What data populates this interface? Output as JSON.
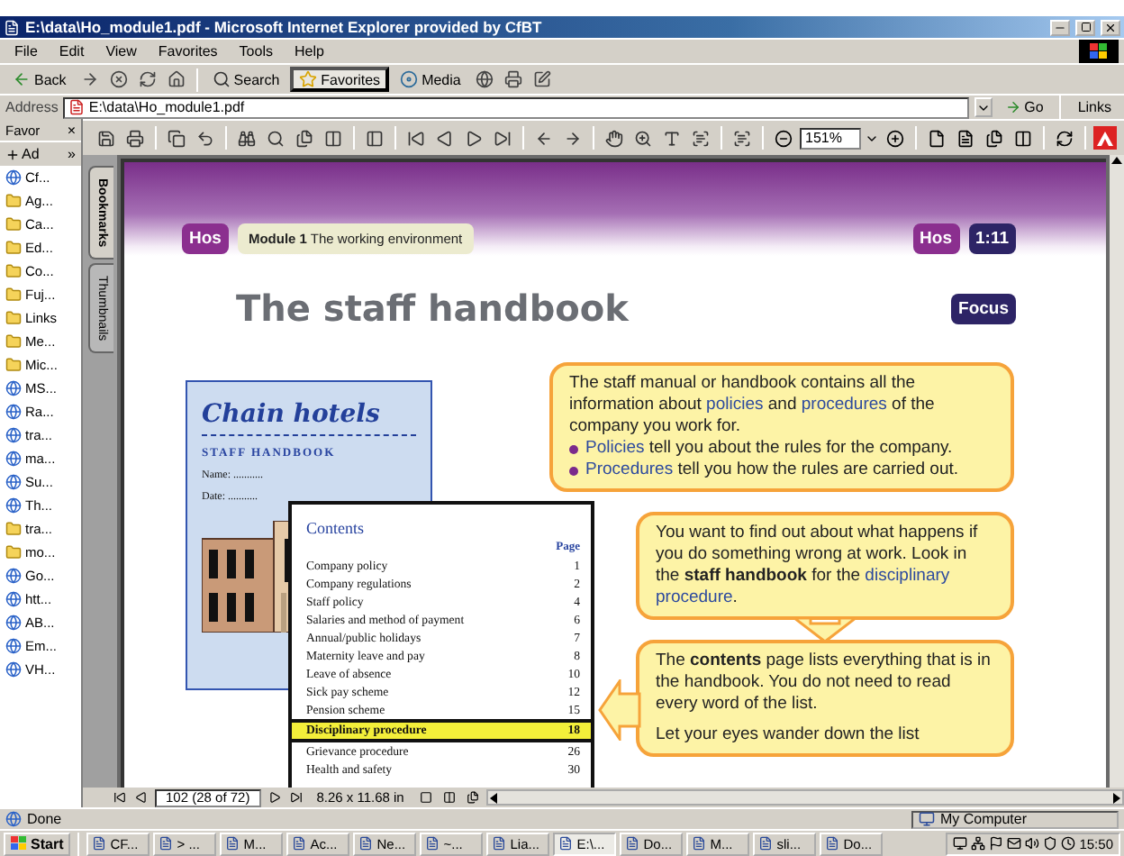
{
  "window": {
    "title": "E:\\data\\Ho_module1.pdf - Microsoft Internet Explorer provided by CfBT"
  },
  "menu": [
    "File",
    "Edit",
    "View",
    "Favorites",
    "Tools",
    "Help"
  ],
  "toolbar": [
    {
      "label": "Back",
      "kind": "back",
      "selected": false
    },
    {
      "label": "Search",
      "kind": "search",
      "selected": false
    },
    {
      "label": "Favorites",
      "kind": "favorites",
      "selected": true
    },
    {
      "label": "Media",
      "kind": "media",
      "selected": false
    }
  ],
  "address": {
    "label": "Address",
    "value": "E:\\data\\Ho_module1.pdf",
    "go": "Go",
    "links": "Links"
  },
  "favorites": {
    "title": "Favor",
    "close": "×",
    "add": "Ad",
    "more": "»",
    "items": [
      {
        "label": "Cf...",
        "kind": "page"
      },
      {
        "label": "Ag...",
        "kind": "folder"
      },
      {
        "label": "Ca...",
        "kind": "folder"
      },
      {
        "label": "Ed...",
        "kind": "folder"
      },
      {
        "label": "Co...",
        "kind": "folder"
      },
      {
        "label": "Fuj...",
        "kind": "folder"
      },
      {
        "label": "Links",
        "kind": "folder"
      },
      {
        "label": "Me...",
        "kind": "folder"
      },
      {
        "label": "Mic...",
        "kind": "folder"
      },
      {
        "label": "MS...",
        "kind": "page"
      },
      {
        "label": "Ra...",
        "kind": "page"
      },
      {
        "label": "tra...",
        "kind": "page"
      },
      {
        "label": "ma...",
        "kind": "page"
      },
      {
        "label": "Su...",
        "kind": "page"
      },
      {
        "label": "Th...",
        "kind": "page"
      },
      {
        "label": "tra...",
        "kind": "folder"
      },
      {
        "label": "mo...",
        "kind": "folder"
      },
      {
        "label": "Go...",
        "kind": "page"
      },
      {
        "label": "htt...",
        "kind": "page"
      },
      {
        "label": "AB...",
        "kind": "page"
      },
      {
        "label": "Em...",
        "kind": "page"
      },
      {
        "label": "VH...",
        "kind": "page"
      }
    ]
  },
  "reader": {
    "zoom": "151%",
    "side_tabs": [
      {
        "label": "Bookmarks",
        "selected": true
      },
      {
        "label": "Thumbnails",
        "selected": false
      }
    ],
    "page_field": "102 (28 of 72)",
    "page_size": "8.26 x 11.68 in"
  },
  "document": {
    "header": {
      "left_badge": "Hos",
      "module": "**Module 1** The working environment",
      "right_badge": "Hos",
      "page_badge": "1:11"
    },
    "title": "The staff handbook",
    "focus": "Focus",
    "cover": {
      "brand": "Chain hotels",
      "title": "STAFF HANDBOOK",
      "fields": [
        "Name: ...........",
        "Date: ..........."
      ]
    },
    "contents": {
      "title": "Contents",
      "page_heading": "Page",
      "rows": [
        {
          "item": "Company policy",
          "page": "1",
          "selected": false
        },
        {
          "item": "Company regulations",
          "page": "2",
          "selected": false
        },
        {
          "item": "Staff policy",
          "page": "4",
          "selected": false
        },
        {
          "item": "Salaries and method of payment",
          "page": "6",
          "selected": false
        },
        {
          "item": "Annual/public holidays",
          "page": "7",
          "selected": false
        },
        {
          "item": "Maternity leave and pay",
          "page": "8",
          "selected": false
        },
        {
          "item": "Leave of absence",
          "page": "10",
          "selected": false
        },
        {
          "item": "Sick pay scheme",
          "page": "12",
          "selected": false
        },
        {
          "item": "Pension scheme",
          "page": "15",
          "selected": false
        },
        {
          "item": "Disciplinary procedure",
          "page": "18",
          "selected": true
        },
        {
          "item": "Grievance procedure",
          "page": "26",
          "selected": false
        },
        {
          "item": "Health and safety",
          "page": "30",
          "selected": false
        }
      ]
    },
    "callouts": [
      {
        "kind": "plain",
        "paragraphs": [
          [
            {
              "text": "The staff manual or handbook contains all the information about ",
              "kind": "plain"
            },
            {
              "text": "policies",
              "kind": "term"
            },
            {
              "text": " and ",
              "kind": "plain"
            },
            {
              "text": "procedures",
              "kind": "term"
            },
            {
              "text": " of the company you work for.",
              "kind": "plain"
            }
          ]
        ],
        "bullets": [
          [
            {
              "text": "Policies",
              "kind": "term"
            },
            {
              "text": " tell you about the rules for the company.",
              "kind": "plain"
            }
          ],
          [
            {
              "text": "Procedures",
              "kind": "term"
            },
            {
              "text": " tell you how the rules are carried out.",
              "kind": "plain"
            }
          ]
        ]
      },
      {
        "kind": "down",
        "paragraphs": [
          [
            {
              "text": "You want to find out about what happens if you do something wrong at work. Look in the ",
              "kind": "plain"
            },
            {
              "text": "staff handbook",
              "kind": "bold"
            },
            {
              "text": " for the ",
              "kind": "plain"
            },
            {
              "text": "disciplinary procedure",
              "kind": "term"
            },
            {
              "text": ".",
              "kind": "plain"
            }
          ]
        ]
      },
      {
        "kind": "left",
        "paragraphs": [
          [
            {
              "text": "The ",
              "kind": "plain"
            },
            {
              "text": "contents",
              "kind": "bold"
            },
            {
              "text": " page lists everything that is in the handbook. You do not need to read every word of the list.",
              "kind": "plain"
            }
          ],
          [
            {
              "text": "Let your eyes wander down the list",
              "kind": "plain"
            }
          ]
        ]
      }
    ]
  },
  "status_bar": {
    "text": "Done",
    "zone": "My Computer"
  },
  "taskbar": {
    "start": "Start",
    "tasks": [
      {
        "label": "CF...",
        "selected": false
      },
      {
        "label": "> ...",
        "selected": false
      },
      {
        "label": "M...",
        "selected": false
      },
      {
        "label": "Ac...",
        "selected": false
      },
      {
        "label": "Ne...",
        "selected": false
      },
      {
        "label": "~...",
        "selected": false
      },
      {
        "label": "Lia...",
        "selected": false
      },
      {
        "label": "E:\\...",
        "selected": true
      },
      {
        "label": "Do...",
        "selected": false
      },
      {
        "label": "M...",
        "selected": false
      },
      {
        "label": "sli...",
        "selected": false
      },
      {
        "label": "Do...",
        "selected": false
      }
    ],
    "clock": "15:50"
  }
}
